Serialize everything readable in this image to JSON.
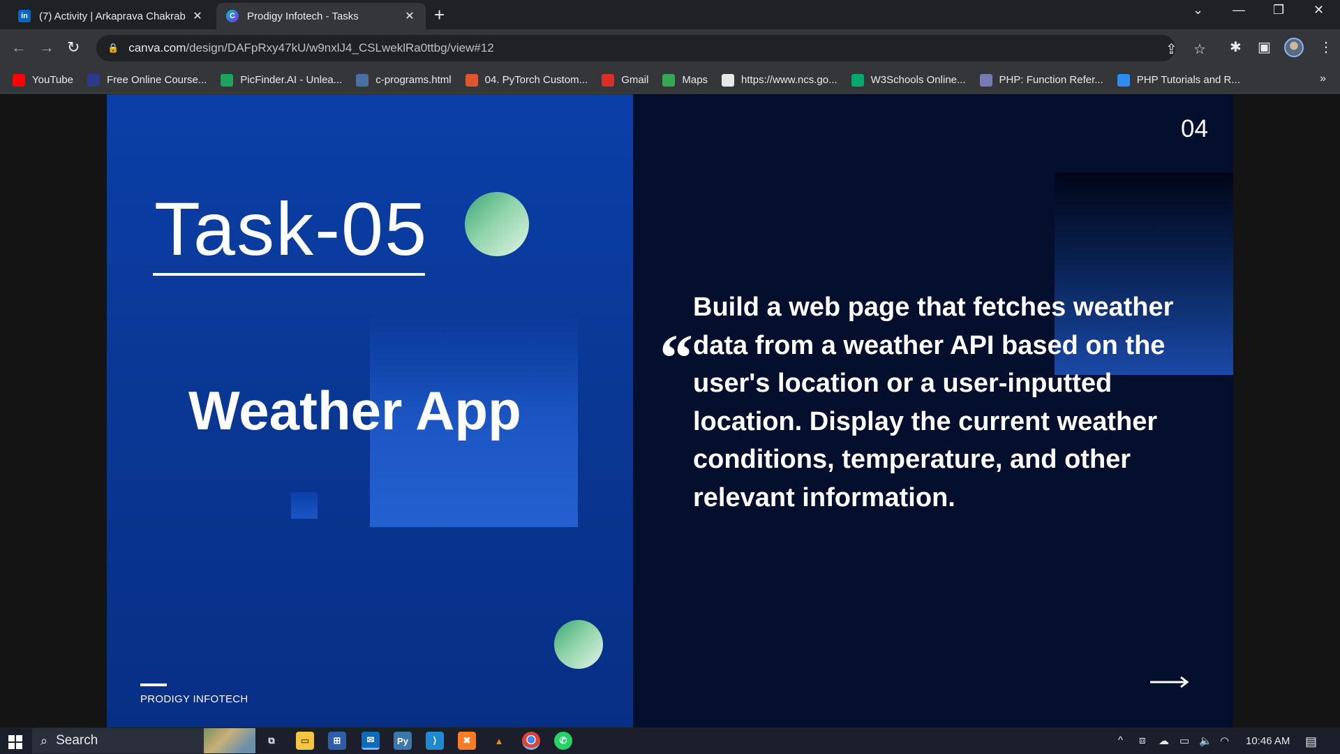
{
  "browser": {
    "tabs": [
      {
        "title": "(7) Activity | Arkaprava Chakrab",
        "favicon": "linkedin-icon",
        "active": false
      },
      {
        "title": "Prodigy Infotech - Tasks",
        "favicon": "canva-icon",
        "active": true
      }
    ],
    "url_host": "canva.com",
    "url_path": "/design/DAFpRxy47kU/w9nxlJ4_CSLweklRa0ttbg/view#12",
    "bookmarks": [
      {
        "label": "YouTube",
        "icon": "youtube-icon",
        "color": "#ff0000"
      },
      {
        "label": "Free Online Course...",
        "icon": "course-icon",
        "color": "#2d3a8c"
      },
      {
        "label": "PicFinder.AI - Unlea...",
        "icon": "picfinder-icon",
        "color": "#1fa35c"
      },
      {
        "label": "c-programs.html",
        "icon": "file-icon",
        "color": "#4a6fa5"
      },
      {
        "label": "04. PyTorch Custom...",
        "icon": "pytorch-icon",
        "color": "#e0562c"
      },
      {
        "label": "Gmail",
        "icon": "gmail-icon",
        "color": "#d93025"
      },
      {
        "label": "Maps",
        "icon": "maps-icon",
        "color": "#34a853"
      },
      {
        "label": "https://www.ncs.go...",
        "icon": "ncs-icon",
        "color": "#e8e8e8"
      },
      {
        "label": "W3Schools Online...",
        "icon": "w3schools-icon",
        "color": "#04aa6d"
      },
      {
        "label": "PHP: Function Refer...",
        "icon": "php-icon",
        "color": "#777bb3"
      },
      {
        "label": "PHP Tutorials and R...",
        "icon": "php-tutorials-icon",
        "color": "#2d8cf0"
      }
    ],
    "more_bookmarks": "»"
  },
  "slide": {
    "task_title": "Task-05",
    "app_title": "Weather App",
    "brand": "PRODIGY INFOTECH",
    "page_number": "04",
    "quote_mark": "“",
    "description": "Build a web page that fetches weather data from a weather API based on the user's location or a user-inputted location. Display the current weather conditions, temperature, and other relevant information.",
    "colors": {
      "left_panel": "#0b3fa8",
      "right_panel": "#030f2c",
      "accent_green": "#8fd2a8"
    }
  },
  "taskbar": {
    "search_placeholder": "Search",
    "time": "10:46 AM",
    "apps": [
      "task-view-icon",
      "file-explorer-icon",
      "microsoft-store-icon",
      "mail-icon",
      "python-idle-icon",
      "vscode-icon",
      "xampp-icon",
      "vlc-icon",
      "chrome-icon",
      "whatsapp-icon"
    ]
  }
}
